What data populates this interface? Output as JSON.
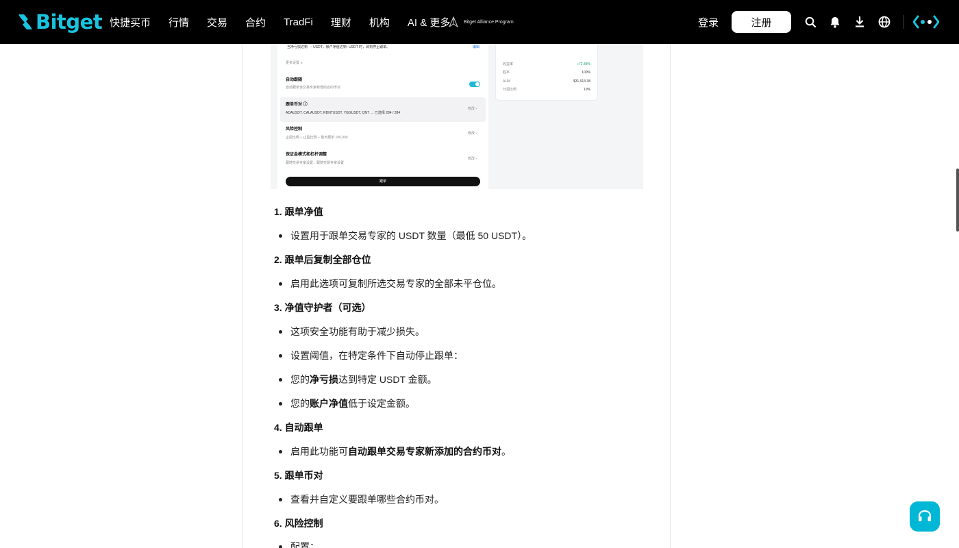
{
  "header": {
    "logo": "Bitget",
    "nav": [
      "快捷买币",
      "行情",
      "交易",
      "合约",
      "TradFi",
      "理财",
      "机构",
      "AI & 更多"
    ],
    "alliance": "Bitget Alliance Program",
    "login": "登录",
    "register": "注册",
    "icons": [
      "search-icon",
      "bell-icon",
      "download-icon",
      "globe-icon",
      "brand-mark-icon"
    ]
  },
  "colors": {
    "accent": "#00b7d6",
    "nav_bg": "#000000",
    "toggle": "#1fb9d4"
  },
  "screenshot": {
    "top_line": {
      "a": "当净亏损达到 ",
      "b": " – USDT，账户净值达到 ",
      "c": " – USDT 时，即刻停止跟单。",
      "edit": "编辑"
    },
    "more": "更多设置 ∧",
    "auto_follow": {
      "title": "自动跟随",
      "desc": "自动跟单该交易专家新增的合约币对"
    },
    "pairs": {
      "title": "跟单币对 ⓘ",
      "list": "ADAUSDT, CALAUSDT, RDNTUSDT, YGGUSDT, QNT …  已选择 284 / 284",
      "action": "修改 ›"
    },
    "risk": {
      "title": "风险控制",
      "desc": "止损比例 –   止盈比例 –   最大跟单 100,000",
      "action": "修改 ›"
    },
    "margin": {
      "title": "保证金模式和杠杆调整",
      "desc": "跟随交易专家设置，跟随交易专家设置",
      "action": "修改 ›"
    },
    "button": "跟单",
    "side": [
      {
        "label": "收益率",
        "value": "+72.48%"
      },
      {
        "label": "胜率",
        "value": "100%"
      },
      {
        "label": "AUM",
        "value": "$31,913.38"
      },
      {
        "label": "分润比例",
        "value": "10%"
      }
    ]
  },
  "content": {
    "s1": {
      "title": "1. 跟单净值",
      "items": [
        "设置用于跟单交易专家的 USDT 数量（最低 50 USDT）。"
      ]
    },
    "s2": {
      "title": "2. 跟单后复制全部仓位",
      "items": [
        "启用此选项可复制所选交易专家的全部未平仓位。"
      ]
    },
    "s3": {
      "title": "3. 净值守护者（可选）",
      "items": [
        "这项安全功能有助于减少损失。",
        "设置阈值，在特定条件下自动停止跟单："
      ],
      "loss": {
        "pre": "您的",
        "bold": "净亏损",
        "post": "达到特定 USDT 金额。"
      },
      "equity": {
        "pre": "您的",
        "bold": "账户净值",
        "post": "低于设定金额。"
      }
    },
    "s4": {
      "title": "4. 自动跟单",
      "pre": "启用此功能可",
      "bold": "自动跟单交易专家新添加的合约币对",
      "post": "。"
    },
    "s5": {
      "title": "5. 跟单币对",
      "items": [
        "查看并自定义要跟单哪些合约币对。"
      ]
    },
    "s6": {
      "title": "6. 风险控制",
      "items": [
        "配置："
      ]
    }
  }
}
